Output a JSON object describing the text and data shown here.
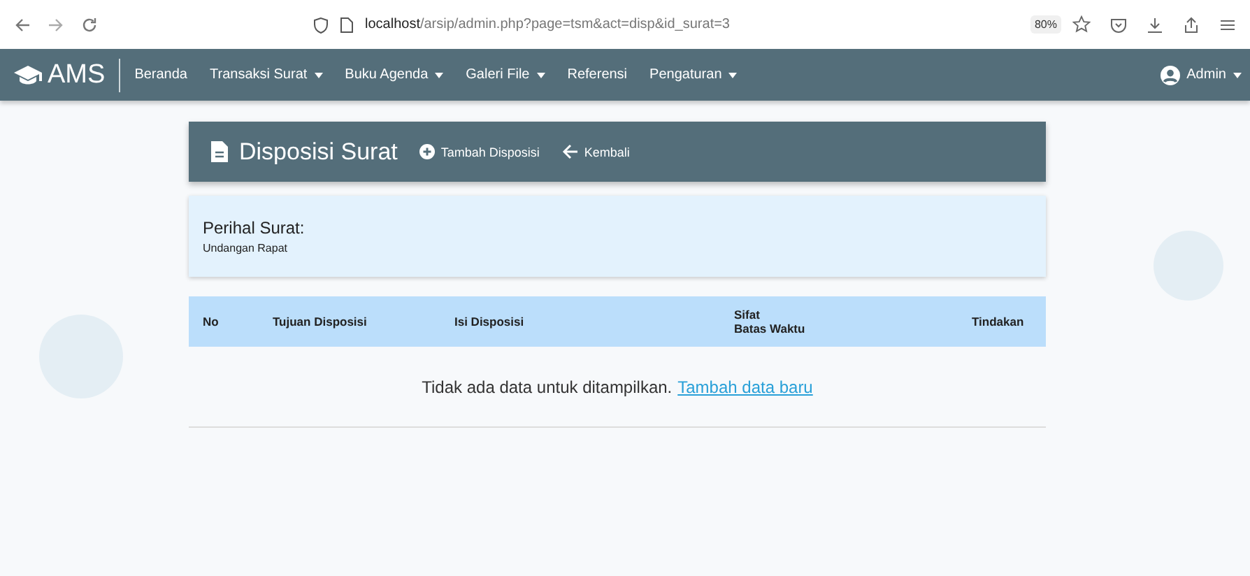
{
  "browser": {
    "url_host": "localhost",
    "url_path": "/arsip/admin.php?page=tsm&act=disp&id_surat=3",
    "zoom": "80%"
  },
  "navbar": {
    "brand": "AMS",
    "items": [
      {
        "label": "Beranda",
        "has_menu": false
      },
      {
        "label": "Transaksi Surat",
        "has_menu": true
      },
      {
        "label": "Buku Agenda",
        "has_menu": true
      },
      {
        "label": "Galeri File",
        "has_menu": true
      },
      {
        "label": "Referensi",
        "has_menu": false
      },
      {
        "label": "Pengaturan",
        "has_menu": true
      }
    ],
    "user": {
      "label": "Admin",
      "has_menu": true
    }
  },
  "page_header": {
    "title": "Disposisi Surat",
    "actions": [
      {
        "label": "Tambah Disposisi",
        "kind": "add"
      },
      {
        "label": "Kembali",
        "kind": "back"
      }
    ]
  },
  "perihal": {
    "label": "Perihal Surat:",
    "value": "Undangan Rapat"
  },
  "table": {
    "columns": [
      [
        "No"
      ],
      [
        "Tujuan Disposisi"
      ],
      [
        "Isi Disposisi"
      ],
      [
        "Sifat",
        "Batas Waktu"
      ],
      [
        "Tindakan"
      ]
    ],
    "empty_message": "Tidak ada data untuk ditampilkan.",
    "empty_link": "Tambah data baru"
  }
}
